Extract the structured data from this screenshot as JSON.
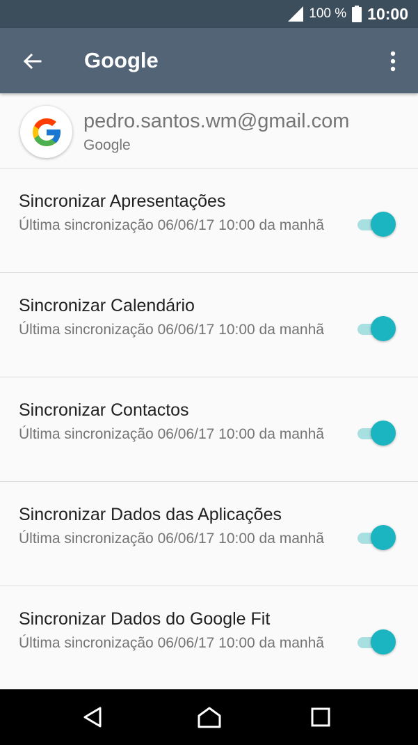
{
  "status_bar": {
    "battery_percent": "100 %",
    "time": "10:00"
  },
  "app_bar": {
    "title": "Google"
  },
  "account": {
    "email": "pedro.santos.wm@gmail.com",
    "provider": "Google"
  },
  "sync_items": [
    {
      "title": "Sincronizar Apresentações",
      "subtitle": "Última sincronização 06/06/17 10:00 da manhã",
      "enabled": true
    },
    {
      "title": "Sincronizar Calendário",
      "subtitle": "Última sincronização 06/06/17 10:00 da manhã",
      "enabled": true
    },
    {
      "title": "Sincronizar Contactos",
      "subtitle": "Última sincronização 06/06/17 10:00 da manhã",
      "enabled": true
    },
    {
      "title": "Sincronizar Dados das Aplicações",
      "subtitle": "Última sincronização 06/06/17 10:00 da manhã",
      "enabled": true
    },
    {
      "title": "Sincronizar Dados do Google Fit",
      "subtitle": "Última sincronização 06/06/17 10:00 da manhã",
      "enabled": true
    }
  ],
  "colors": {
    "status_bar": "#3c4d5c",
    "app_bar": "#536476",
    "toggle_on_thumb": "#1ab5c1",
    "toggle_on_track": "#a8dfe1"
  },
  "icons": {
    "back": "arrow-left-icon",
    "more": "more-vert-icon",
    "signal": "signal-icon",
    "battery": "battery-icon",
    "google": "google-logo-icon",
    "nav_back": "nav-back-icon",
    "nav_home": "nav-home-icon",
    "nav_recents": "nav-recents-icon"
  }
}
